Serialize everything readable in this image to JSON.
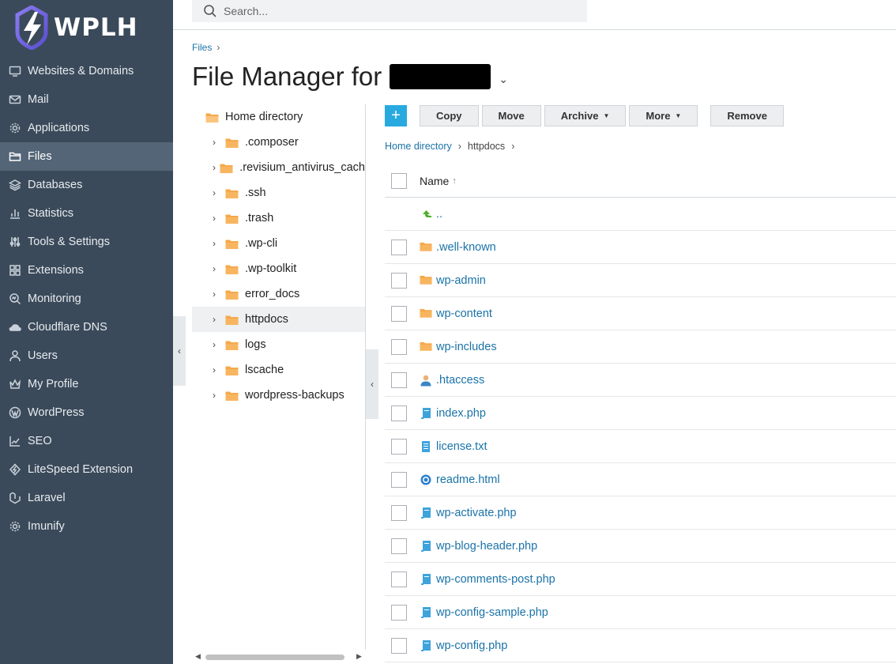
{
  "brand": {
    "name": "WPLH"
  },
  "sidebar": {
    "items": [
      {
        "label": "Websites & Domains",
        "icon": "monitor-icon"
      },
      {
        "label": "Mail",
        "icon": "mail-icon"
      },
      {
        "label": "Applications",
        "icon": "gear-icon"
      },
      {
        "label": "Files",
        "icon": "folder-icon",
        "active": true
      },
      {
        "label": "Databases",
        "icon": "layers-icon"
      },
      {
        "label": "Statistics",
        "icon": "bar-chart-icon"
      },
      {
        "label": "Tools & Settings",
        "icon": "sliders-icon"
      },
      {
        "label": "Extensions",
        "icon": "blocks-icon"
      },
      {
        "label": "Monitoring",
        "icon": "magnifier-icon"
      },
      {
        "label": "Cloudflare DNS",
        "icon": "cloud-icon"
      },
      {
        "label": "Users",
        "icon": "user-icon"
      },
      {
        "label": "My Profile",
        "icon": "crown-icon"
      },
      {
        "label": "WordPress",
        "icon": "wordpress-icon"
      },
      {
        "label": "SEO",
        "icon": "trend-icon"
      },
      {
        "label": "LiteSpeed Extension",
        "icon": "litespeed-icon"
      },
      {
        "label": "Laravel",
        "icon": "laravel-icon"
      },
      {
        "label": "Imunify",
        "icon": "cog-icon"
      }
    ]
  },
  "search": {
    "placeholder": "Search..."
  },
  "breadcrumb": {
    "root": "Files"
  },
  "page": {
    "title": "File Manager for"
  },
  "tree": {
    "root": "Home directory",
    "items": [
      ".composer",
      ".revisium_antivirus_cach",
      ".ssh",
      ".trash",
      ".wp-cli",
      ".wp-toolkit",
      "error_docs",
      "httpdocs",
      "logs",
      "lscache",
      "wordpress-backups"
    ],
    "selected": "httpdocs"
  },
  "toolbar": {
    "add": "+",
    "copy": "Copy",
    "move": "Move",
    "archive": "Archive",
    "more": "More",
    "remove": "Remove"
  },
  "path": {
    "home": "Home directory",
    "current": "httpdocs"
  },
  "list": {
    "header_name": "Name",
    "rows": [
      {
        "name": "..",
        "type": "up"
      },
      {
        "name": ".well-known",
        "type": "folder"
      },
      {
        "name": "wp-admin",
        "type": "folder"
      },
      {
        "name": "wp-content",
        "type": "folder"
      },
      {
        "name": "wp-includes",
        "type": "folder"
      },
      {
        "name": ".htaccess",
        "type": "user"
      },
      {
        "name": "index.php",
        "type": "php"
      },
      {
        "name": "license.txt",
        "type": "txt"
      },
      {
        "name": "readme.html",
        "type": "html"
      },
      {
        "name": "wp-activate.php",
        "type": "php"
      },
      {
        "name": "wp-blog-header.php",
        "type": "php"
      },
      {
        "name": "wp-comments-post.php",
        "type": "php"
      },
      {
        "name": "wp-config-sample.php",
        "type": "php"
      },
      {
        "name": "wp-config.php",
        "type": "php"
      }
    ]
  },
  "colors": {
    "sidebar_bg": "#3b4a5a",
    "active_bg": "#536577",
    "link": "#1a73a8",
    "accent": "#28aae1",
    "folder": "#f5a94a"
  }
}
